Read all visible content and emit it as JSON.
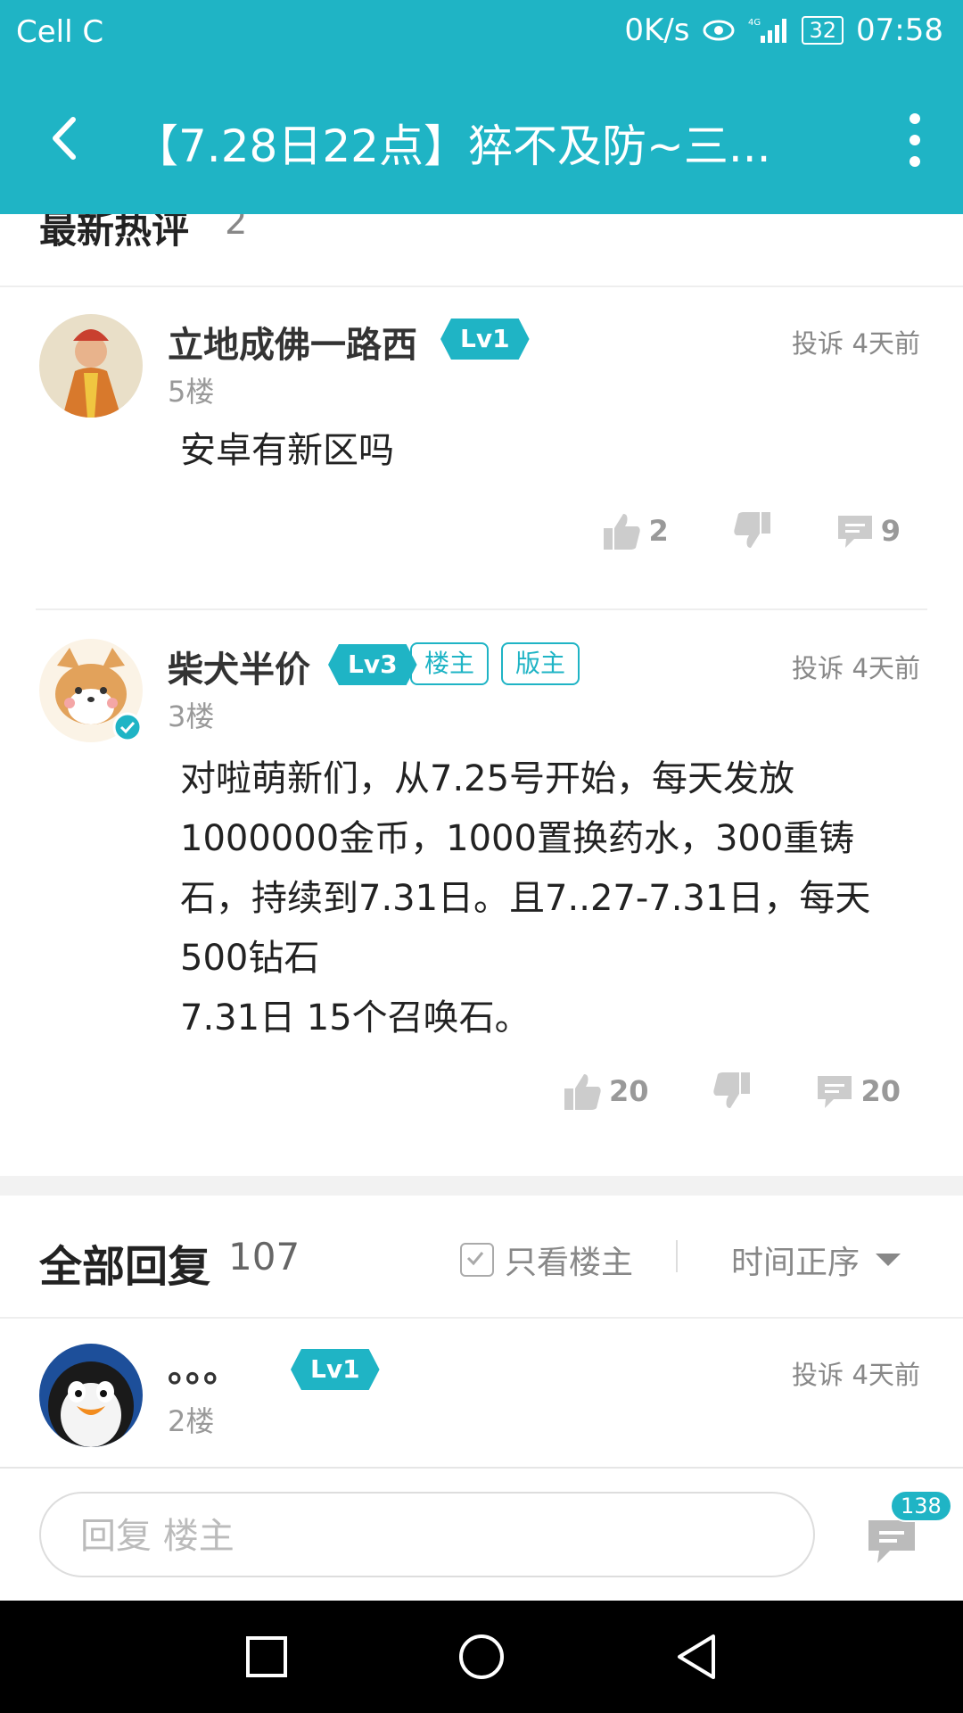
{
  "status_bar": {
    "carrier": "Cell C",
    "speed": "0K/s",
    "battery": "32",
    "time": "07:58"
  },
  "header": {
    "title": "【7.28日22点】猝不及防~三..."
  },
  "hot_section": {
    "title": "最新热评",
    "count": "2"
  },
  "hot_comments": [
    {
      "user": "立地成佛一路西",
      "level": "Lv1",
      "floor": "5楼",
      "report": "投诉",
      "time": "4天前",
      "content": "安卓有新区吗",
      "likes": "2",
      "replies": "9"
    },
    {
      "user": "柴犬半价",
      "level": "Lv3",
      "tags": [
        "楼主",
        "版主"
      ],
      "floor": "3楼",
      "report": "投诉",
      "time": "4天前",
      "content": "对啦萌新们，从7.25号开始，每天发放\n1000000金币，1000置换药水，300重铸\n石，持续到7.31日。且7..27-7.31日，每天\n500钻石\n7.31日 15个召唤石。",
      "likes": "20",
      "replies": "20"
    }
  ],
  "all_section": {
    "title": "全部回复",
    "count": "107",
    "only_op": "只看楼主",
    "sort": "时间正序"
  },
  "replies": [
    {
      "user": "。。。",
      "level": "Lv1",
      "floor": "2楼",
      "report": "投诉",
      "time": "4天前"
    }
  ],
  "reply_bar": {
    "placeholder": "回复  楼主",
    "message_count": "138"
  },
  "colors": {
    "accent": "#1fb4c5"
  }
}
